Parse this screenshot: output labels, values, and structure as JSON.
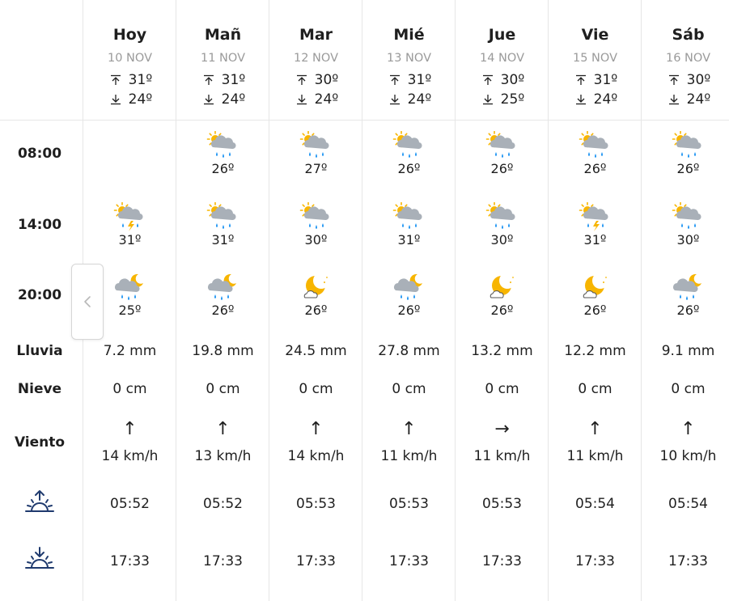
{
  "row_labels": {
    "t0800": "08:00",
    "t1400": "14:00",
    "t2000": "20:00",
    "rain": "Lluvia",
    "snow": "Nieve",
    "wind": "Viento"
  },
  "days": [
    {
      "name": "Hoy",
      "date": "10 NOV",
      "max": "31º",
      "min": "24º",
      "s0800": null,
      "s1400": {
        "icon": "storm-sun-icon",
        "temp": "31º"
      },
      "s2000": {
        "icon": "rain-moon-icon",
        "temp": "25º"
      },
      "rain": "7.2 mm",
      "snow": "0 cm",
      "wind_dir": "↑",
      "wind": "14 km/h",
      "sunrise": "05:52",
      "sunset": "17:33"
    },
    {
      "name": "Mañ",
      "date": "11 NOV",
      "max": "31º",
      "min": "24º",
      "s0800": {
        "icon": "rain-sun-icon",
        "temp": "26º"
      },
      "s1400": {
        "icon": "rain-sun-icon",
        "temp": "31º"
      },
      "s2000": {
        "icon": "rain-moon-icon",
        "temp": "26º"
      },
      "rain": "19.8 mm",
      "snow": "0 cm",
      "wind_dir": "↑",
      "wind": "13 km/h",
      "sunrise": "05:52",
      "sunset": "17:33"
    },
    {
      "name": "Mar",
      "date": "12 NOV",
      "max": "30º",
      "min": "24º",
      "s0800": {
        "icon": "rain-sun-icon",
        "temp": "27º"
      },
      "s1400": {
        "icon": "rain-sun-icon",
        "temp": "30º"
      },
      "s2000": {
        "icon": "cloudy-moon-icon",
        "temp": "26º"
      },
      "rain": "24.5 mm",
      "snow": "0 cm",
      "wind_dir": "↑",
      "wind": "14 km/h",
      "sunrise": "05:53",
      "sunset": "17:33"
    },
    {
      "name": "Mié",
      "date": "13 NOV",
      "max": "31º",
      "min": "24º",
      "s0800": {
        "icon": "rain-sun-icon",
        "temp": "26º"
      },
      "s1400": {
        "icon": "rain-sun-icon",
        "temp": "31º"
      },
      "s2000": {
        "icon": "rain-moon-icon",
        "temp": "26º"
      },
      "rain": "27.8 mm",
      "snow": "0 cm",
      "wind_dir": "↑",
      "wind": "11 km/h",
      "sunrise": "05:53",
      "sunset": "17:33"
    },
    {
      "name": "Jue",
      "date": "14 NOV",
      "max": "30º",
      "min": "25º",
      "s0800": {
        "icon": "rain-sun-icon",
        "temp": "26º"
      },
      "s1400": {
        "icon": "rain-sun-icon",
        "temp": "30º"
      },
      "s2000": {
        "icon": "cloudy-moon-icon",
        "temp": "26º"
      },
      "rain": "13.2 mm",
      "snow": "0 cm",
      "wind_dir": "→",
      "wind": "11 km/h",
      "sunrise": "05:53",
      "sunset": "17:33"
    },
    {
      "name": "Vie",
      "date": "15 NOV",
      "max": "31º",
      "min": "24º",
      "s0800": {
        "icon": "rain-sun-icon",
        "temp": "26º"
      },
      "s1400": {
        "icon": "storm-sun-icon",
        "temp": "31º"
      },
      "s2000": {
        "icon": "cloudy-moon-icon",
        "temp": "26º"
      },
      "rain": "12.2 mm",
      "snow": "0 cm",
      "wind_dir": "↑",
      "wind": "11 km/h",
      "sunrise": "05:54",
      "sunset": "17:33"
    },
    {
      "name": "Sáb",
      "date": "16 NOV",
      "max": "30º",
      "min": "24º",
      "s0800": {
        "icon": "rain-sun-icon",
        "temp": "26º"
      },
      "s1400": {
        "icon": "rain-sun-icon",
        "temp": "30º"
      },
      "s2000": {
        "icon": "rain-moon-icon",
        "temp": "26º"
      },
      "rain": "9.1 mm",
      "snow": "0 cm",
      "wind_dir": "↑",
      "wind": "10 km/h",
      "sunrise": "05:54",
      "sunset": "17:33"
    }
  ],
  "nav": {
    "prev_icon": "chevron-left-icon"
  },
  "colors": {
    "sun": "#f7b500",
    "cloud": "#a9b0b8",
    "rain": "#2196f3",
    "text_muted": "#9a9a9a",
    "divider": "#e6e6e6"
  }
}
